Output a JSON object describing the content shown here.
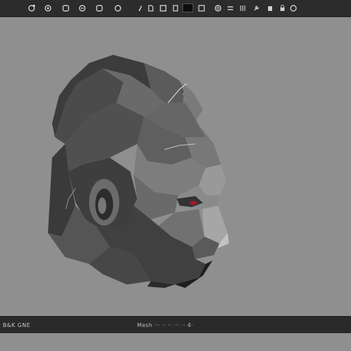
{
  "toolbar": {
    "icons": [
      "orbit-icon",
      "vertex-icon",
      "edge-icon",
      "face-icon",
      "object-icon",
      "brush-icon",
      "knife-icon",
      "document-icon",
      "color-swatch",
      "camera-icon",
      "move-icon",
      "sliders-icon",
      "wrench-icon",
      "save-icon",
      "settings-icon"
    ],
    "swatch_color": "#0e0e0e"
  },
  "viewport": {
    "background": "#8f8f8f",
    "subject": "low-poly-head-model"
  },
  "status": {
    "left_text": "B&K GNE",
    "mid_text": "Mesh ··· ·· ·· ··· ·· 4·"
  }
}
